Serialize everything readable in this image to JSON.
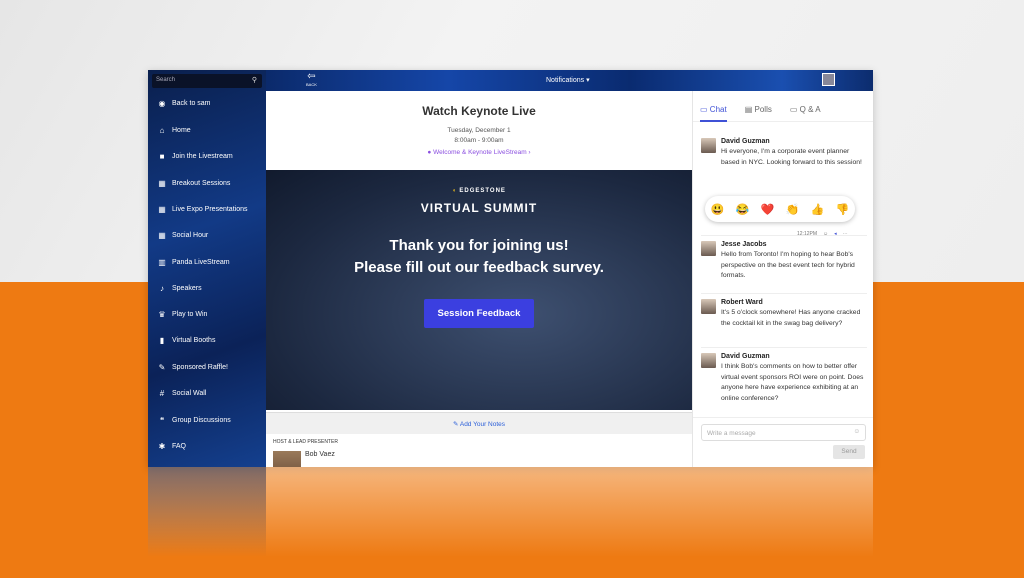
{
  "search": {
    "placeholder": "Search"
  },
  "sidebar": {
    "items": [
      {
        "label": "Back to sam",
        "icon": "back-circle-icon"
      },
      {
        "label": "Home",
        "icon": "home-icon"
      },
      {
        "label": "Join the Livestream",
        "icon": "video-icon"
      },
      {
        "label": "Breakout Sessions",
        "icon": "calendar-icon"
      },
      {
        "label": "Live Expo Presentations",
        "icon": "calendar-icon"
      },
      {
        "label": "Social Hour",
        "icon": "calendar-icon"
      },
      {
        "label": "Panda LiveStream",
        "icon": "film-icon"
      },
      {
        "label": "Speakers",
        "icon": "microphone-icon"
      },
      {
        "label": "Play to Win",
        "icon": "trophy-icon"
      },
      {
        "label": "Virtual Booths",
        "icon": "bookmark-icon"
      },
      {
        "label": "Sponsored Raffle!",
        "icon": "magic-icon"
      },
      {
        "label": "Social Wall",
        "icon": "hashtag-icon"
      },
      {
        "label": "Group Discussions",
        "icon": "comments-icon"
      },
      {
        "label": "FAQ",
        "icon": "gear-icon"
      }
    ]
  },
  "topbar": {
    "back": "BACK",
    "notifications": "Notifications ▾"
  },
  "session": {
    "title": "Watch Keynote Live",
    "date": "Tuesday, December 1",
    "time": "8:00am - 9:00am",
    "link": "Welcome & Keynote LiveStream ›"
  },
  "video": {
    "brand": "EDGESTONE",
    "event": "VIRTUAL SUMMIT",
    "line1": "Thank you for joining us!",
    "line2": "Please fill out our feedback survey.",
    "button": "Session Feedback"
  },
  "notes": {
    "label": "Add Your Notes"
  },
  "host": {
    "heading": "HOST & LEAD PRESENTER",
    "name": "Bob Vaez"
  },
  "chat": {
    "tabs": [
      "Chat",
      "Polls",
      "Q & A"
    ],
    "messages": [
      {
        "name": "David Guzman",
        "text": "Hi everyone, I'm a corporate event planner based in NYC. Looking forward to this session!"
      },
      {
        "name": "Jesse Jacobs",
        "text": "Hello from Toronto! I'm hoping to hear Bob's perspective on the best event tech for hybrid formats."
      },
      {
        "name": "Robert Ward",
        "text": "It's 5 o'clock somewhere! Has anyone cracked the cocktail kit in the swag bag delivery?"
      },
      {
        "name": "David Guzman",
        "text": "I think Bob's comments on how to better offer virtual event sponsors ROI were on point. Does anyone here have experience exhibiting at an online conference?"
      }
    ],
    "reactions": [
      "😃",
      "😂",
      "❤️",
      "👏",
      "👍",
      "👎"
    ],
    "time": "12:12PM",
    "input_placeholder": "Write a message",
    "send": "Send"
  },
  "colors": {
    "accent": "#3f51d6",
    "button": "#3b3fe0",
    "background_orange": "#ee7a12",
    "link_purple": "#8b4fe0"
  }
}
